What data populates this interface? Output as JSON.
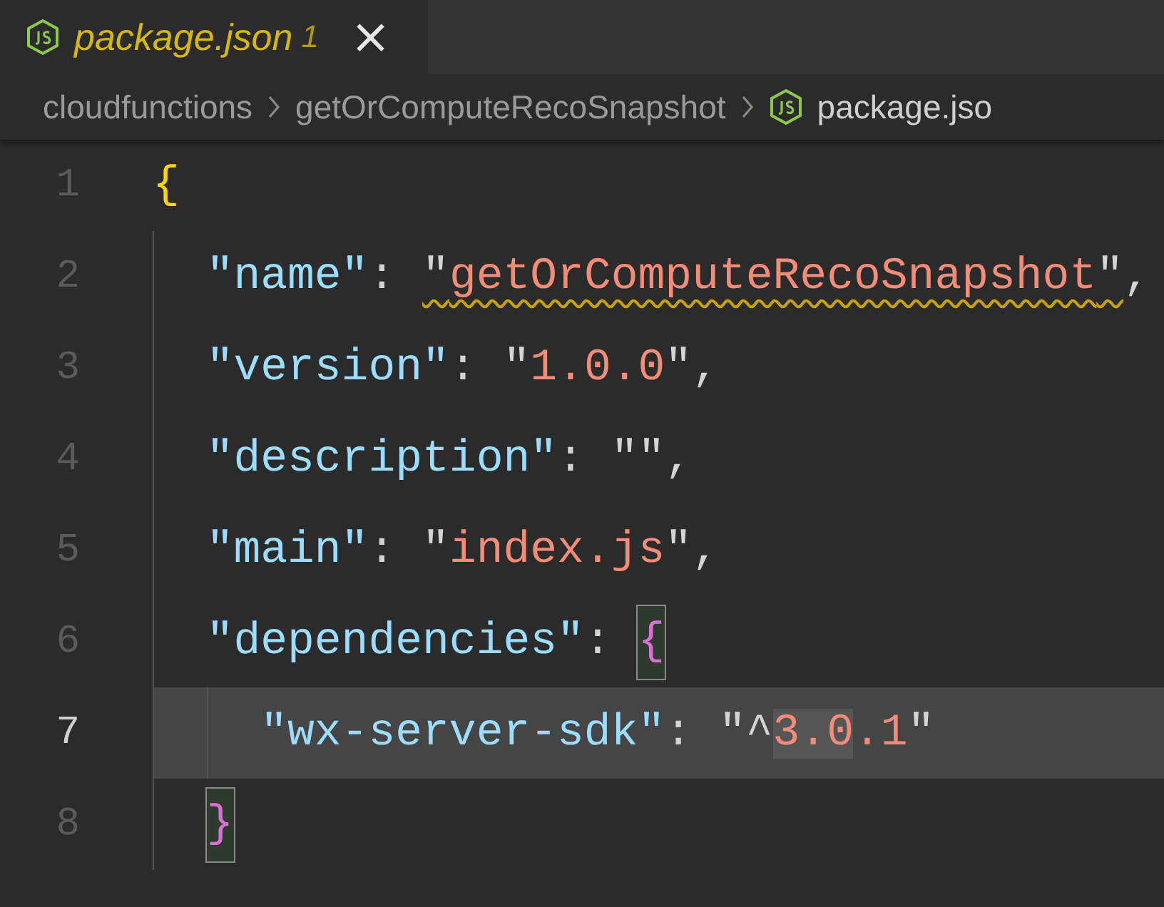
{
  "tab": {
    "title": "package.json",
    "problems": "1",
    "close": "×",
    "selected": true
  },
  "breadcrumbs": [
    {
      "label": "cloudfunctions",
      "kind": "folder"
    },
    {
      "label": "getOrComputeRecoSnapshot",
      "kind": "folder"
    },
    {
      "label": "package.jso",
      "kind": "file"
    }
  ],
  "lines": [
    {
      "number": "1",
      "active": false,
      "tokens": [
        {
          "text": "{",
          "kind": "open"
        }
      ]
    },
    {
      "number": "2",
      "active": false,
      "tokens": [
        {
          "text": "\"name\"",
          "kind": "key"
        },
        {
          "text": ": ",
          "kind": "punct"
        },
        {
          "text": "\"",
          "kind": "quote",
          "warning": true
        },
        {
          "text": "getOrComputeRecoSnapshot",
          "kind": "string",
          "warning": true
        },
        {
          "text": "\"",
          "kind": "quote",
          "warning": true
        },
        {
          "text": ",",
          "kind": "punct"
        }
      ]
    },
    {
      "number": "3",
      "active": false,
      "tokens": [
        {
          "text": "\"version\"",
          "kind": "key"
        },
        {
          "text": ": ",
          "kind": "punct"
        },
        {
          "text": "\"",
          "kind": "quote"
        },
        {
          "text": "1.0.0",
          "kind": "string"
        },
        {
          "text": "\",",
          "kind": "quote"
        }
      ]
    },
    {
      "number": "4",
      "active": false,
      "tokens": [
        {
          "text": "\"description\"",
          "kind": "key"
        },
        {
          "text": ": \"\",",
          "kind": "punct"
        }
      ]
    },
    {
      "number": "5",
      "active": false,
      "tokens": [
        {
          "text": "\"main\"",
          "kind": "key"
        },
        {
          "text": ": ",
          "kind": "punct"
        },
        {
          "text": "\"",
          "kind": "quote"
        },
        {
          "text": "index.js",
          "kind": "string"
        },
        {
          "text": "\",",
          "kind": "quote"
        }
      ]
    },
    {
      "number": "6",
      "active": false,
      "tokens": [
        {
          "text": "\"dependencies\"",
          "kind": "key"
        },
        {
          "text": ": ",
          "kind": "punct"
        },
        {
          "text": "{",
          "kind": "open",
          "matched": true
        }
      ]
    },
    {
      "number": "7",
      "active": true,
      "tokens": [
        {
          "text": "\"wx-server-sdk\"",
          "kind": "key"
        },
        {
          "text": ": ",
          "kind": "punct"
        },
        {
          "text": "\"^",
          "kind": "quote"
        },
        {
          "text": "3.0",
          "kind": "string",
          "highlighted": true
        },
        {
          "text": ".1",
          "kind": "string"
        },
        {
          "text": "\"",
          "kind": "quote"
        }
      ]
    },
    {
      "number": "8",
      "active": false,
      "tokens": [
        {
          "text": "}",
          "kind": "close",
          "matched": true
        }
      ]
    }
  ]
}
